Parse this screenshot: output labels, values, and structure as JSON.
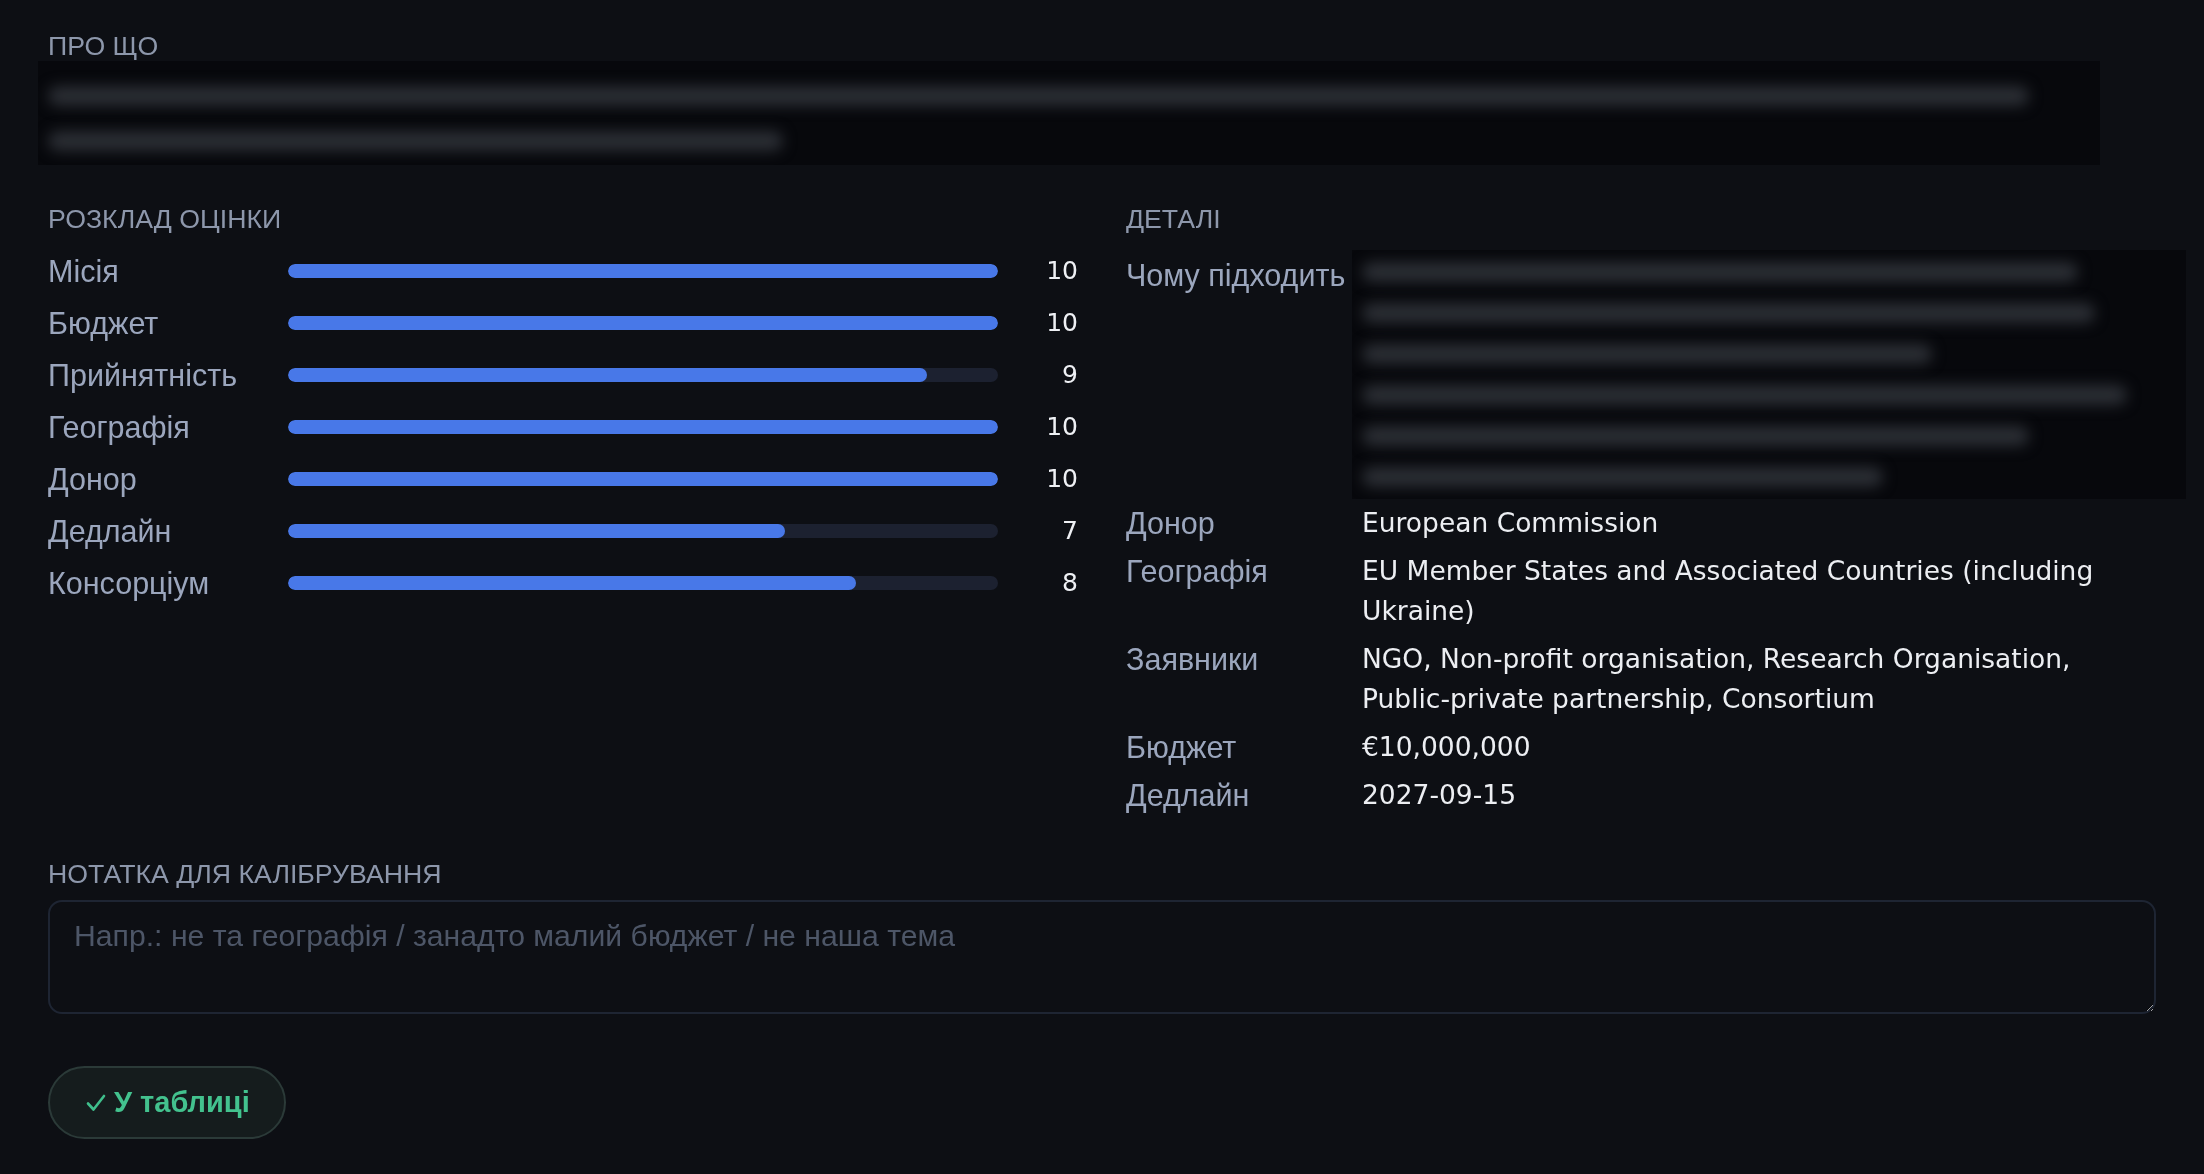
{
  "about": {
    "heading": "ПРО ЩО",
    "kind": "redacted"
  },
  "score_breakdown": {
    "heading": "РОЗКЛАД ОЦІНКИ",
    "rows": [
      {
        "label": "Місія",
        "level": 1,
        "score": "10"
      },
      {
        "label": "Бюджет",
        "level": 1,
        "score": "10"
      },
      {
        "label": "Прийнятність",
        "level": 0.9,
        "score": "9"
      },
      {
        "label": "Географія",
        "level": 1,
        "score": "10"
      },
      {
        "label": "Донор",
        "level": 1,
        "score": "10"
      },
      {
        "label": "Дедлайн",
        "level": 0.7,
        "score": "7"
      },
      {
        "label": "Консорціум",
        "level": 0.8,
        "score": "8"
      }
    ]
  },
  "details": {
    "heading": "ДЕТАЛІ",
    "rows": [
      {
        "label": "Чому підходить",
        "kind": "redacted"
      },
      {
        "label": "Донор",
        "kind": "text",
        "value": "European Commission"
      },
      {
        "label": "Географія",
        "kind": "text",
        "value": "EU Member States and Associated Countries (including Ukraine)"
      },
      {
        "label": "Заявники",
        "kind": "text",
        "value": "NGO, Non-profit organisation, Research Organisation, Public-private partnership, Consortium"
      },
      {
        "label": "Бюджет",
        "kind": "text",
        "value": "€10,000,000"
      },
      {
        "label": "Дедлайн",
        "kind": "text",
        "value": "2027-09-15"
      }
    ]
  },
  "note": {
    "heading": "НОТАТКА ДЛЯ КАЛІБРУВАННЯ",
    "placeholder": "Напр.: не та географія / занадто малий бюджет / не наша тема"
  },
  "button": {
    "label": "У таблиці"
  }
}
